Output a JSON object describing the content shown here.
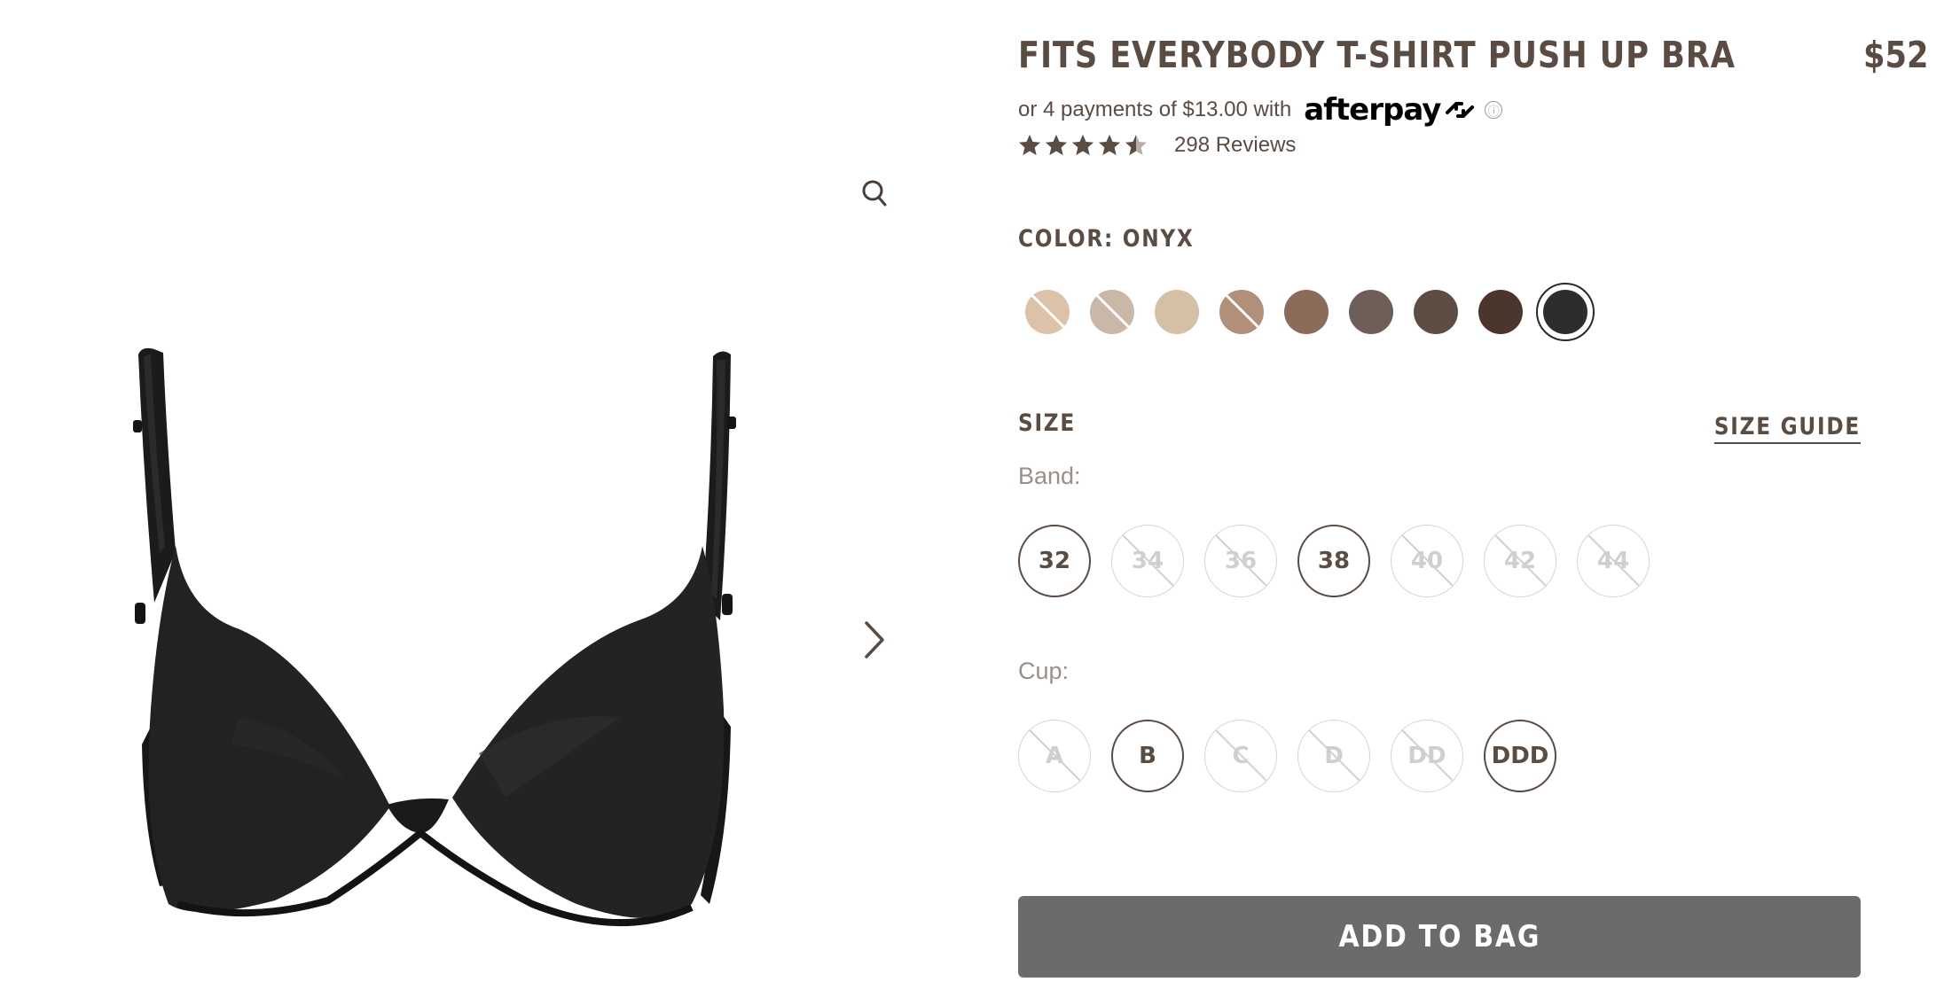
{
  "product": {
    "title": "FITS EVERYBODY T-SHIRT PUSH UP BRA",
    "price": "$52",
    "rating": 4.5,
    "rating_max": 5,
    "reviews_label": "298 Reviews"
  },
  "afterpay": {
    "text": "or 4 payments of $13.00 with",
    "brand": "afterpay",
    "info_glyph": "ⓘ"
  },
  "gallery": {
    "image_icon": "bra-product-image",
    "zoom_icon": "magnifier-icon",
    "next_icon": "chevron-right-icon"
  },
  "color": {
    "label": "COLOR: ONYX",
    "swatches": [
      {
        "hex": "#dcc3a8",
        "available": false,
        "selected": false
      },
      {
        "hex": "#c9b7a7",
        "available": false,
        "selected": false
      },
      {
        "hex": "#d5bfa6",
        "available": true,
        "selected": false
      },
      {
        "hex": "#b1907a",
        "available": false,
        "selected": false
      },
      {
        "hex": "#8d6b5a",
        "available": true,
        "selected": false
      },
      {
        "hex": "#6e5e58",
        "available": true,
        "selected": false
      },
      {
        "hex": "#5d4c42",
        "available": true,
        "selected": false
      },
      {
        "hex": "#4a362c",
        "available": true,
        "selected": false
      },
      {
        "hex": "#2c2d2f",
        "available": true,
        "selected": true
      }
    ]
  },
  "size": {
    "label": "SIZE",
    "guide_label": "SIZE GUIDE",
    "band_label": "Band:",
    "cup_label": "Cup:",
    "bands": [
      {
        "label": "32",
        "available": true
      },
      {
        "label": "34",
        "available": false
      },
      {
        "label": "36",
        "available": false
      },
      {
        "label": "38",
        "available": true
      },
      {
        "label": "40",
        "available": false
      },
      {
        "label": "42",
        "available": false
      },
      {
        "label": "44",
        "available": false
      }
    ],
    "cups": [
      {
        "label": "A",
        "available": false
      },
      {
        "label": "B",
        "available": true
      },
      {
        "label": "C",
        "available": false
      },
      {
        "label": "D",
        "available": false
      },
      {
        "label": "DD",
        "available": false
      },
      {
        "label": "DDD",
        "available": true
      }
    ]
  },
  "cta": {
    "add_to_bag": "ADD TO BAG",
    "button_color": "#6b6b6b"
  },
  "colors": {
    "text": "#5a4c42",
    "muted": "#9b8f86",
    "disabled": "#cfcfcf"
  }
}
